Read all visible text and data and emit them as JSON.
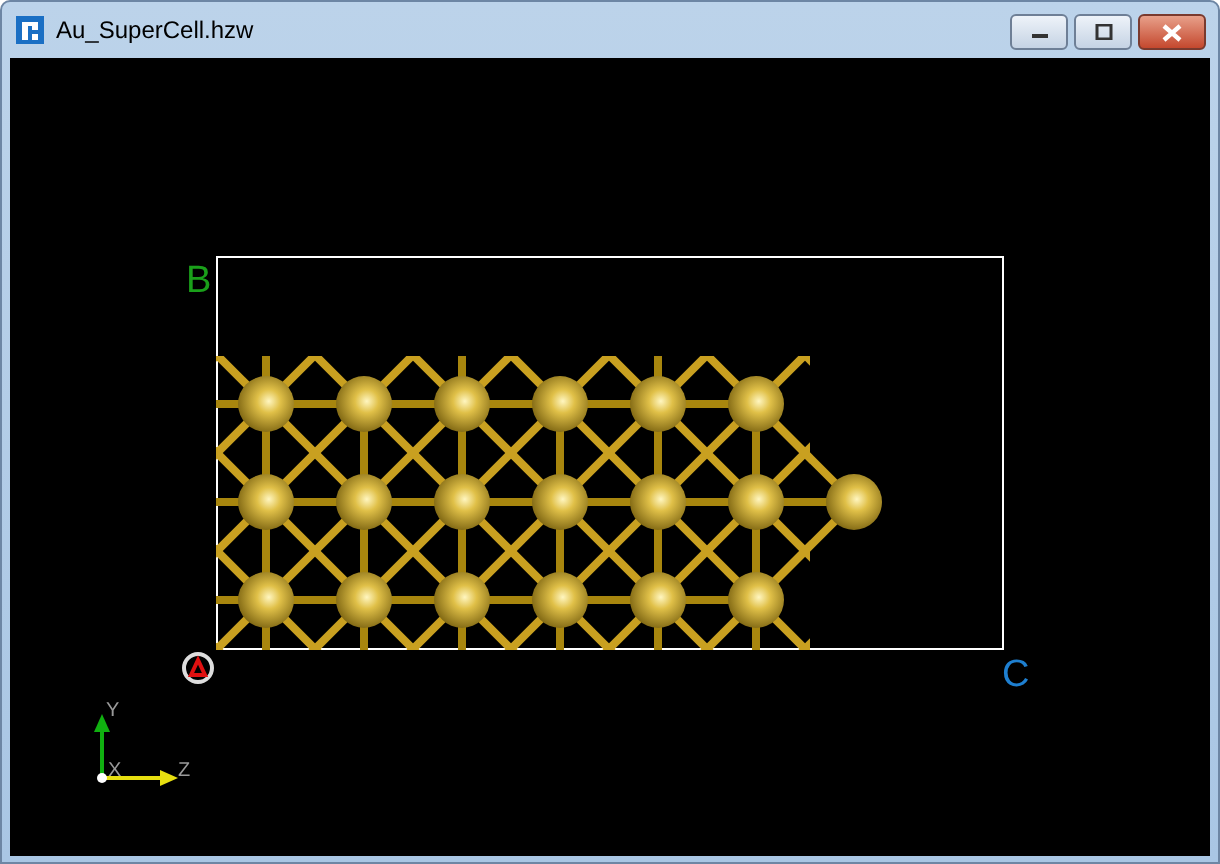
{
  "window": {
    "title": "Au_SuperCell.hzw"
  },
  "cell_labels": [
    "B",
    "C"
  ],
  "axes": [
    "Y",
    "X",
    "Z"
  ]
}
